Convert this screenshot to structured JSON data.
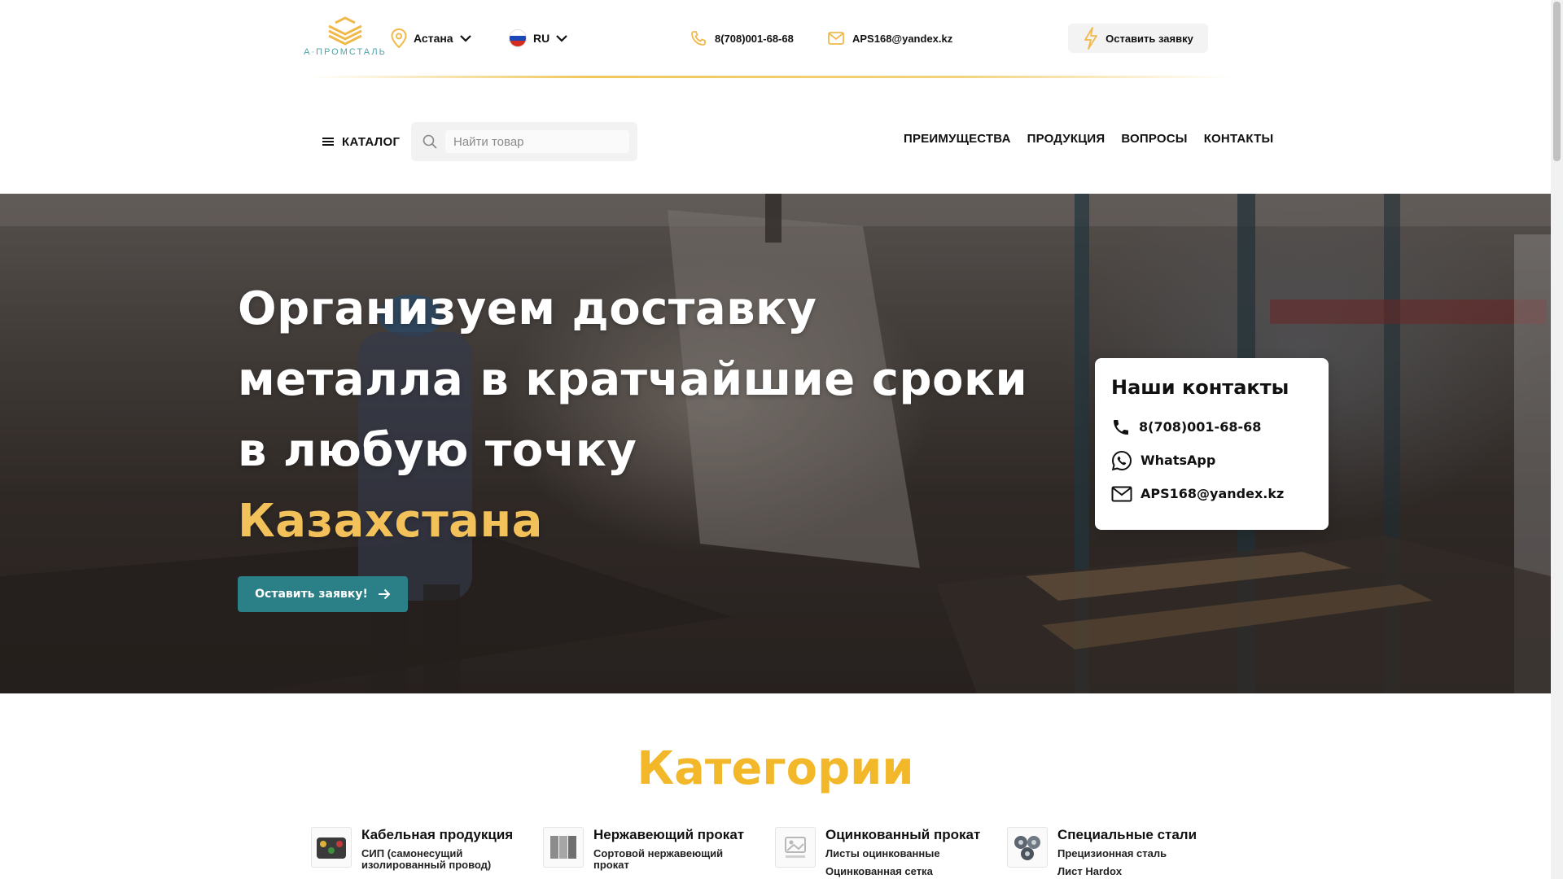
{
  "header": {
    "logo_text": "А·ПРОМСТАЛЬ",
    "city": "Астана",
    "language": "RU",
    "phone": "8(708)001-68-68",
    "email": "APS168@yandex.kz",
    "request_label": "Оставить заявку"
  },
  "nav": {
    "catalog_label": "КАТАЛОГ",
    "search_placeholder": "Найти товар",
    "links": [
      "ПРЕИМУЩЕСТВА",
      "ПРОДУКЦИЯ",
      "ВОПРОСЫ",
      "КОНТАКТЫ"
    ]
  },
  "hero": {
    "title_line1": "Организуем доставку",
    "title_line2": "металла в кратчайшие сроки",
    "title_line3": "в любую точку",
    "title_accent": "Казахстана",
    "cta_label": "Оставить заявку!"
  },
  "contacts": {
    "title": "Наши контакты",
    "phone": "8(708)001-68-68",
    "whatsapp": "WhatsApp",
    "email": "APS168@yandex.kz"
  },
  "categories": {
    "heading": "Категории",
    "items": [
      {
        "title": "Кабельная продукция",
        "sub": "СИП (самонесущий изолированный провод)",
        "sub2": ""
      },
      {
        "title": "Нержавеющий прокат",
        "sub": "Сортовой нержавеющий прокат",
        "sub2": ""
      },
      {
        "title": "Оцинкованный прокат",
        "sub": "Листы оцинкованные",
        "sub2": "Оцинкованная сетка"
      },
      {
        "title": "Специальные стали",
        "sub": "Прецизионная сталь",
        "sub2": "Лист Hardox"
      }
    ]
  },
  "colors": {
    "accent_gold": "#f2c15a",
    "heading_gold": "#f2b829",
    "cta_teal": "#2b7f86",
    "logo_teal": "#4fa3a8"
  }
}
